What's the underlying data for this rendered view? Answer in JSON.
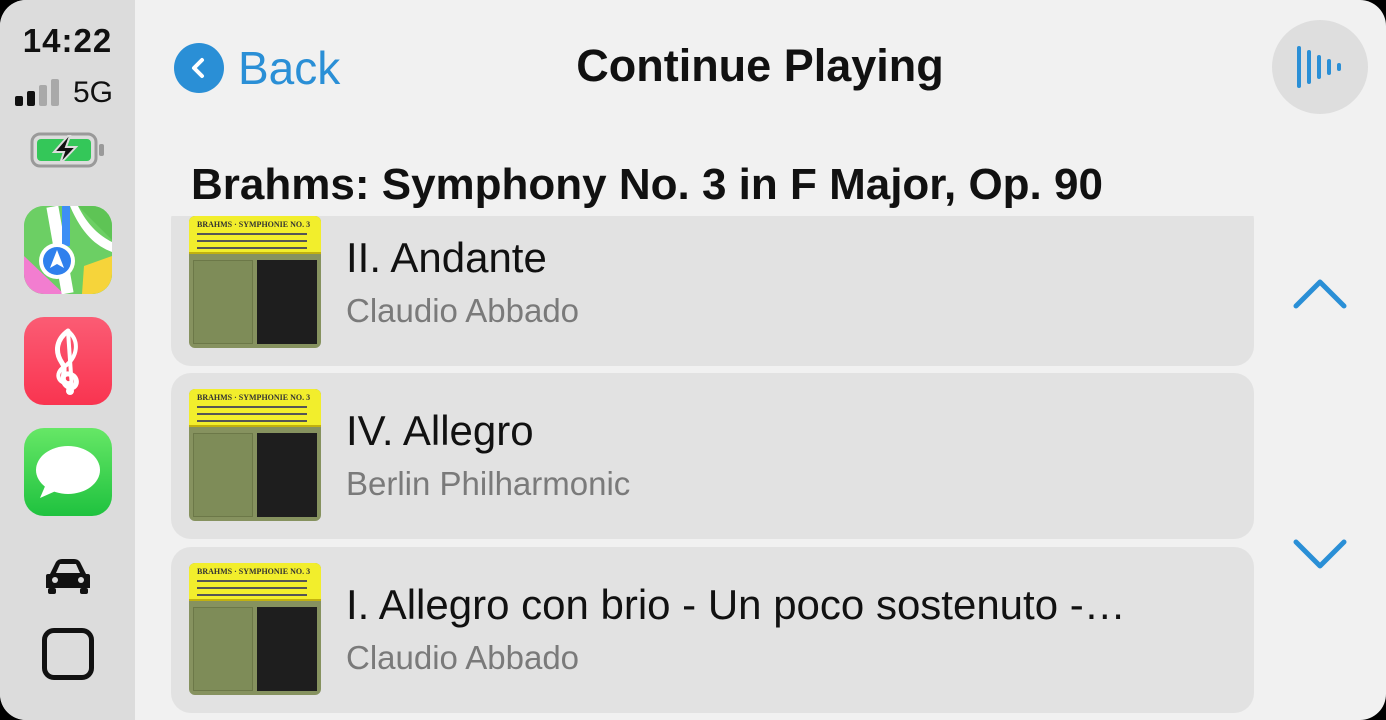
{
  "status": {
    "time": "14:22",
    "network": "5G",
    "signal_bars": 2,
    "battery_level": 0.85,
    "battery_charging": true
  },
  "dock": {
    "apps": [
      {
        "name": "Maps",
        "icon": "maps-icon"
      },
      {
        "name": "Music",
        "icon": "music-icon"
      },
      {
        "name": "Messages",
        "icon": "messages-icon"
      }
    ],
    "car_icon": "car-icon",
    "home_icon": "home-square-icon"
  },
  "header": {
    "back_label": "Back",
    "title": "Continue Playing",
    "siri_icon": "siri-waveform-icon"
  },
  "section": {
    "title": "Brahms: Symphony No. 3 in F Major, Op. 90"
  },
  "tracks": [
    {
      "title": "II. Andante",
      "artist": "Claudio Abbado"
    },
    {
      "title": "IV. Allegro",
      "artist": "Berlin Philharmonic"
    },
    {
      "title": "I. Allegro con brio - Un poco sostenuto -…",
      "artist": "Claudio Abbado"
    }
  ],
  "album_art": {
    "label": "BRAHMS · SYMPHONIE NO. 3"
  },
  "colors": {
    "accent": "#2a8fd6",
    "background": "#f1f1f1",
    "dock": "#dcdcdc",
    "row": "#e2e2e2",
    "secondary_text": "#7a7a7a"
  }
}
